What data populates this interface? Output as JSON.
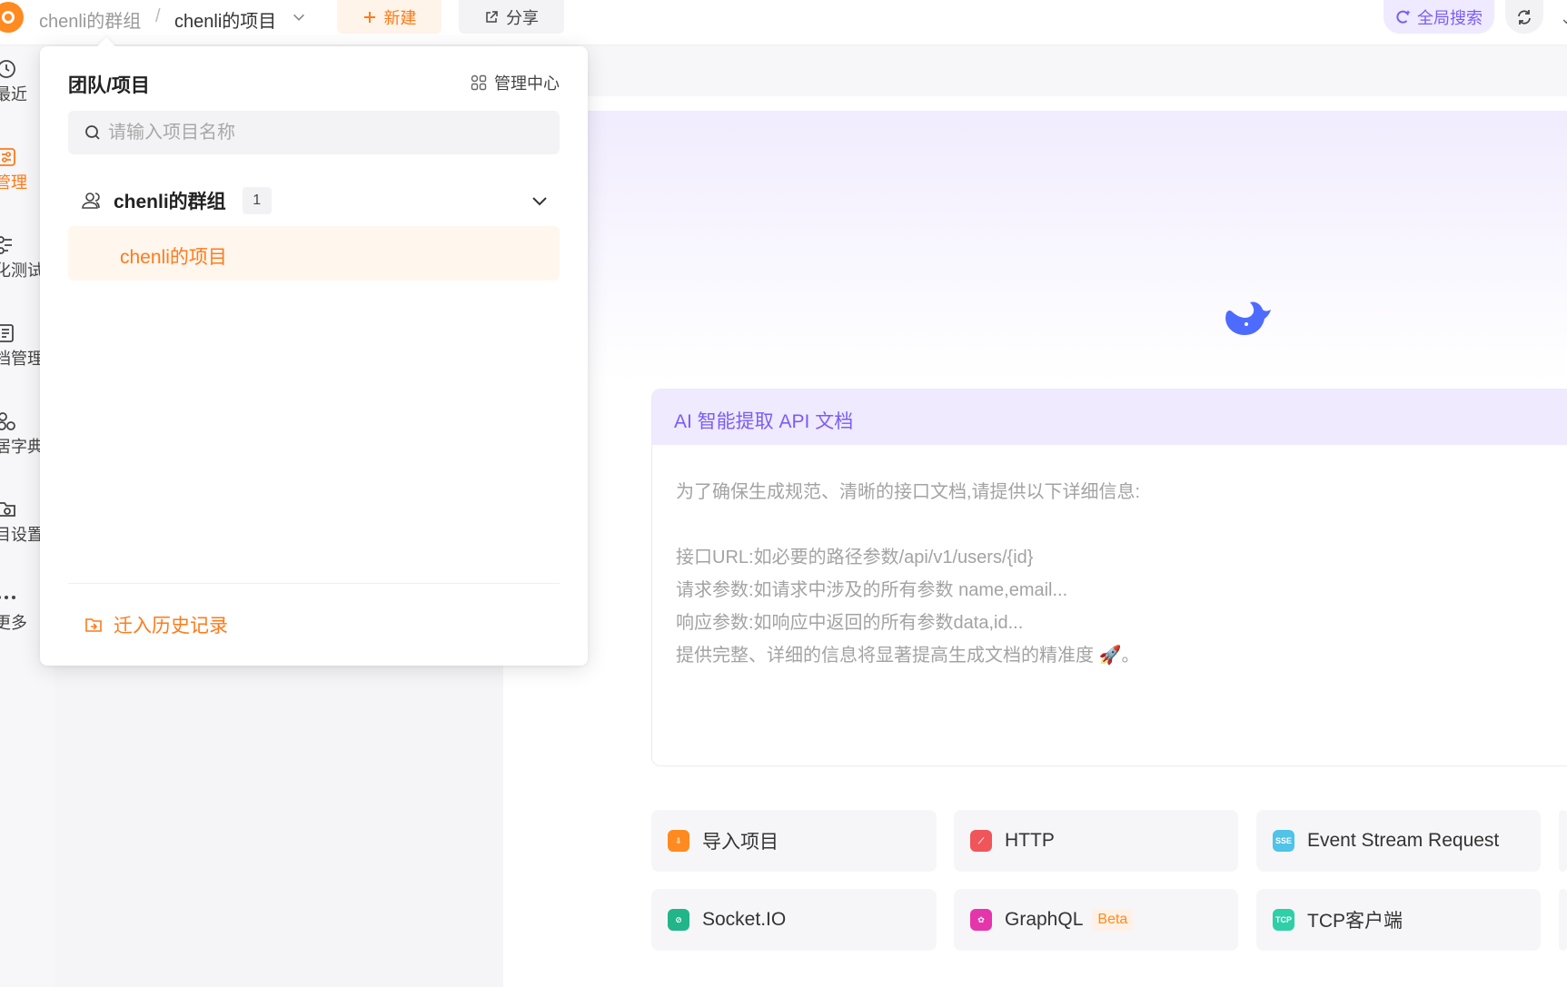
{
  "topbar": {
    "team_name": "chenli的群组",
    "separator": "/",
    "project_name": "chenli的项目",
    "new_label": "新建",
    "share_label": "分享",
    "search_label": "全局搜索"
  },
  "rail": {
    "items": [
      {
        "label": "最近",
        "icon": "clock-icon"
      },
      {
        "label": "管理",
        "icon": "settings-sliders-icon"
      },
      {
        "label": "化测试",
        "icon": "flow-icon"
      },
      {
        "label": "档管理",
        "icon": "doc-list-icon"
      },
      {
        "label": "居字典",
        "icon": "shapes-icon"
      },
      {
        "label": "目设置",
        "icon": "folder-gear-icon"
      },
      {
        "label": "更多",
        "icon": "more-icon"
      }
    ]
  },
  "popup": {
    "title": "团队/项目",
    "admin_label": "管理中心",
    "search_placeholder": "请输入项目名称",
    "group_name": "chenli的群组",
    "group_count": "1",
    "project_name": "chenli的项目",
    "history_label": "迁入历史记录"
  },
  "ai_card": {
    "title": "AI 智能提取 API 文档",
    "intro": "为了确保生成规范、清晰的接口文档,请提供以下详细信息:",
    "lines": [
      "接口URL:如必要的路径参数/api/v1/users/{id}",
      "请求参数:如请求中涉及的所有参数 name,email...",
      "响应参数:如响应中返回的所有参数data,id...",
      "提供完整、详细的信息将显著提高生成文档的精准度 🚀。"
    ]
  },
  "tiles": [
    {
      "label": "导入项目",
      "icon": "import-icon",
      "color": "#ff8a1f"
    },
    {
      "label": "HTTP",
      "icon": "http-link-icon",
      "color": "#f0555a"
    },
    {
      "label": "Event Stream Request",
      "icon": "sse-icon",
      "color": "#4fc3e8",
      "icon_text": "SSE"
    },
    {
      "label": "Socket.IO",
      "icon": "socketio-icon",
      "color": "#22b58a"
    },
    {
      "label": "GraphQL",
      "icon": "graphql-icon",
      "color": "#e535ab",
      "badge": "Beta"
    },
    {
      "label": "TCP客户端",
      "icon": "tcp-icon",
      "color": "#2fcfa8",
      "icon_text": "TCP"
    }
  ],
  "colors": {
    "accent": "#ff7a1a",
    "ai_purple": "#7b5cf5"
  }
}
